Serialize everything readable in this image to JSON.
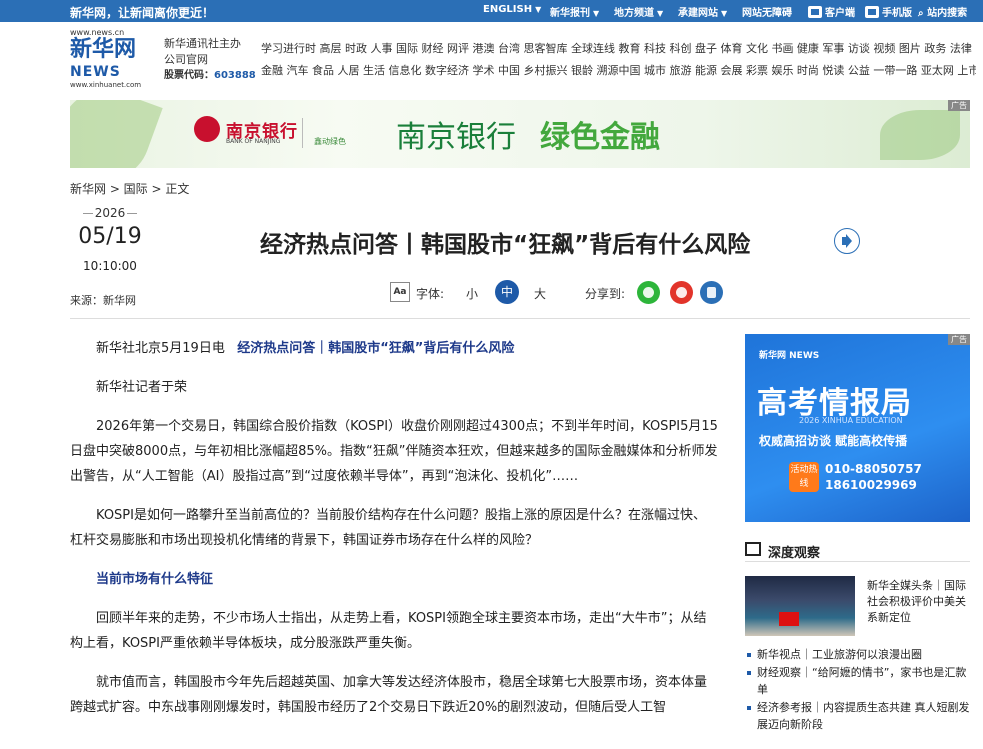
{
  "topbar": {
    "slogan": "新华网，让新闻离你更近！",
    "items": [
      {
        "label": "ENGLISH",
        "caret": true
      },
      {
        "label": "新华报刊",
        "caret": true
      },
      {
        "label": "地方频道",
        "caret": true
      },
      {
        "label": "承建网站",
        "caret": true
      },
      {
        "label": "网站无障碍",
        "caret": false
      },
      {
        "label": "客户端",
        "caret": false
      },
      {
        "label": "手机版",
        "caret": false
      },
      {
        "label": "站内搜索",
        "caret": false
      }
    ]
  },
  "header": {
    "logo_url": "www.news.cn",
    "logo_cn": "新华网",
    "logo_en": "NEWS",
    "logo_url2": "www.xinhuanet.com",
    "brand_line1": "新华通讯社主办",
    "brand_line2": "公司官网",
    "stock_label": "股票代码：",
    "stock_code": "603888"
  },
  "nav": {
    "row1": "学习进行时 高层 时政 人事 国际 财经 网评 港澳 台湾 思客智库 全球连线 教育 科技 科创 盘子 体育 文化 书画 健康 军事 访谈 视频 图片 政务 法律 中央文件",
    "row2": "金融 汽车 食品 人居 生活 信息化 数字经济 学术 中国 乡村振兴 银龄 溯源中国 城市 旅游 能源 会展 彩票 娱乐 时尚 悦读 公益 一带一路 亚太网 上市公司 文化产业"
  },
  "banner": {
    "bank_cn": "南京银行",
    "bank_en": "BANK OF NANJING",
    "sub": "鑫动绿色",
    "big1": "南京银行",
    "big2": "绿色金融",
    "ad_tag": "广告"
  },
  "breadcrumb": "新华网 > 国际 > 正文",
  "meta": {
    "year": "2026",
    "month_day": "05/19",
    "time": "10:10:00",
    "source": "来源：新华网"
  },
  "article": {
    "title": "经济热点问答丨韩国股市“狂飙”背后有什么风险",
    "font_label": "字体:",
    "font_small": "小",
    "font_mid": "中",
    "font_large": "大",
    "share_label": "分享到:",
    "aa_icon": "Aa",
    "dateline": "新华社北京5月19日电",
    "lead_title": "经济热点问答｜韩国股市“狂飙”背后有什么风险",
    "reporter": "新华社记者于荣",
    "p1": "2026年第一个交易日，韩国综合股价指数（KOSPI）收盘价刚刚超过4300点；不到半年时间，KOSPI5月15日盘中突破8000点，与年初相比涨幅超85%。指数“狂飙”伴随资本狂欢，但越来越多的国际金融媒体和分析师发出警告，从“人工智能（AI）股指过高”到“过度依赖半导体”，再到“泡沫化、投机化”……",
    "p2": "KOSPI是如何一路攀升至当前高位的？当前股价结构存在什么问题？股指上涨的原因是什么？在涨幅过快、杠杆交易膨胀和市场出现投机化情绪的背景下，韩国证券市场存在什么样的风险？",
    "section1": "当前市场有什么特征",
    "p3": "回顾半年来的走势，不少市场人士指出，从走势上看，KOSPI领跑全球主要资本市场，走出“大牛市”；从结构上看，KOSPI严重依赖半导体板块，成分股涨跌严重失衡。",
    "p4": "就市值而言，韩国股市今年先后超越英国、加拿大等发达经济体股市，稳居全球第七大股票市场，资本体量跨越式扩容。中东战事刚刚爆发时，韩国股市经历了2个交易日下跌近20%的剧烈波动，但随后受人工智"
  },
  "sidebar": {
    "ad": {
      "logo": "新华网 NEWS",
      "title": "高考情报局",
      "sub1": "2026 XINHUA EDUCATION",
      "sub2": "权威高招访谈  赋能高校传播",
      "hot": "活动热线",
      "phone1": "010-88050757",
      "phone2": "18610029969",
      "ad_tag": "广告"
    },
    "section_title": "深度观察",
    "feature_text": "新华全媒头条｜国际社会积极评价中美关系新定位",
    "list": [
      "新华视点｜工业旅游何以浪漫出圈",
      "财经观察｜“给阿嬷的情书”，家书也是汇款单",
      "经济参考报｜内容提质生态共建 真人短剧发展迈向新阶段"
    ]
  },
  "colors": {
    "topbar": "#2b6fb6",
    "link_blue": "#1e3a8a",
    "bank_red": "#c8102e",
    "green": "#1a7f3a"
  }
}
